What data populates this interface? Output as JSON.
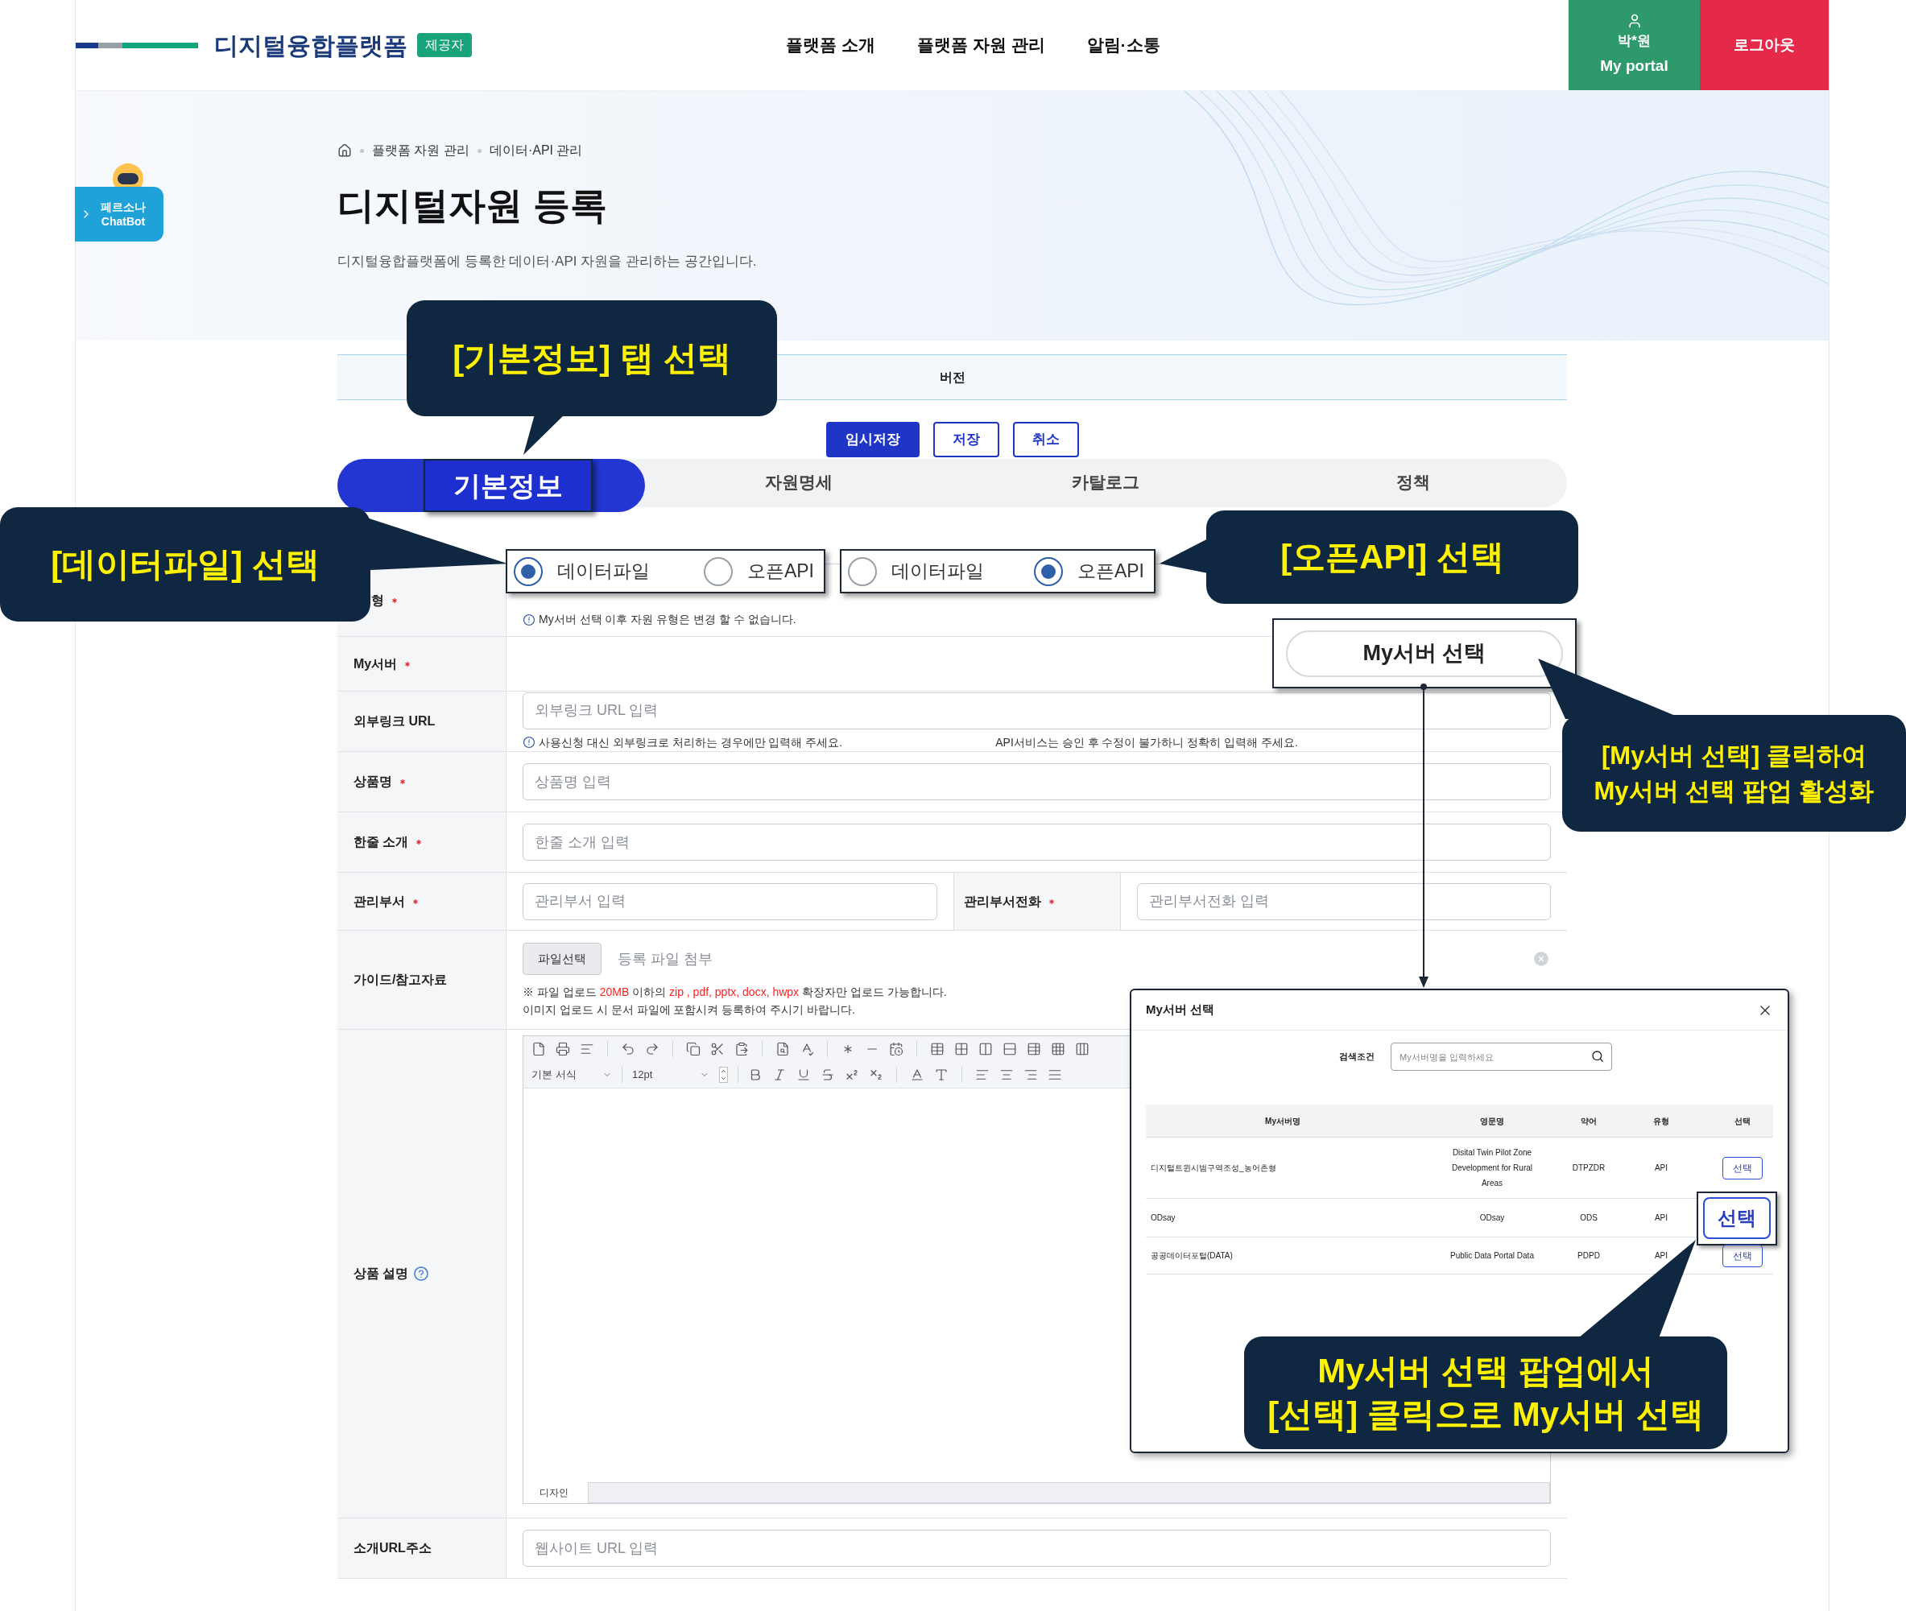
{
  "header": {
    "logo_text": "디지털융합플랫폼",
    "badge": "제공자",
    "nav": [
      "플랫폼 소개",
      "플랫폼 자원 관리",
      "알림·소통"
    ],
    "user_name": "박*원",
    "portal_label": "My portal",
    "logout_label": "로그아웃"
  },
  "chatbot": {
    "line1": "페르소나",
    "line2": "ChatBot"
  },
  "breadcrumb": [
    "플랫폼 자원 관리",
    "데이터·API 관리"
  ],
  "page_title": "디지털자원 등록",
  "page_description": "디지털융합플랫폼에 등록한 데이터·API 자원을 관리하는 공간입니다.",
  "version_label": "버전",
  "actions": [
    {
      "label": "임시저장",
      "kind": "primary"
    },
    {
      "label": "저장",
      "kind": "outline"
    },
    {
      "label": "취소",
      "kind": "outline"
    }
  ],
  "tabs": [
    {
      "label": "기본정보",
      "selected": true
    },
    {
      "label": "자원명세",
      "selected": false
    },
    {
      "label": "카탈로그",
      "selected": false
    },
    {
      "label": "정책",
      "selected": false
    }
  ],
  "form": {
    "rows": [
      {
        "kind": "radio",
        "label": "형",
        "required": true,
        "note": "My서버 선택 이후 자원 유형은 변경 할 수 없습니다."
      },
      {
        "kind": "server",
        "label": "My서버",
        "required": true
      },
      {
        "kind": "input",
        "label": "외부링크 URL",
        "required": false,
        "placeholder": "외부링크 URL 입력",
        "note": "사용신청 대신 외부링크로 처리하는 경우에만 입력해 주세요.",
        "side_note": "API서비스는 승인 후 수정이 불가하니 정확히 입력해 주세요."
      },
      {
        "kind": "input",
        "label": "상품명",
        "required": true,
        "placeholder": "상품명 입력"
      },
      {
        "kind": "input",
        "label": "한줄 소개",
        "required": true,
        "placeholder": "한줄 소개 입력"
      },
      {
        "kind": "split",
        "label": "관리부서",
        "required": true,
        "placeholder": "관리부서 입력",
        "sub_label": "관리부서전화",
        "sub_required": true,
        "sub_placeholder": "관리부서전화 입력"
      },
      {
        "kind": "file",
        "label": "가이드/참고자료",
        "required": false,
        "button": "파일선택",
        "placeholder": "등록 파일 첨부",
        "note_parts": [
          {
            "text": "※ 파일 업로드 ",
            "highlight": false
          },
          {
            "text": "20MB",
            "highlight": true
          },
          {
            "text": " 이하의 ",
            "highlight": false
          },
          {
            "text": "zip , pdf, pptx, docx, hwpx",
            "highlight": true
          },
          {
            "text": " 확장자만 업로드 가능합니다.",
            "highlight": false
          }
        ],
        "note2": "이미지 업로드 시 문서 파일에 포함시켜 등록하여 주시기 바랍니다."
      },
      {
        "kind": "editor",
        "label": "상품 설명",
        "required": false,
        "format": "기본 서식",
        "size": "12pt",
        "design_tab": "디자인"
      },
      {
        "kind": "input",
        "label": "소개URL주소",
        "required": false,
        "placeholder": "웹사이트 URL 입력"
      }
    ]
  },
  "radio_highlights": [
    {
      "options": [
        {
          "label": "데이터파일",
          "selected": true
        },
        {
          "label": "오픈API",
          "selected": false
        }
      ]
    },
    {
      "options": [
        {
          "label": "데이터파일",
          "selected": false
        },
        {
          "label": "오픈API",
          "selected": true
        }
      ]
    }
  ],
  "server_button": "My서버 선택",
  "popup": {
    "title": "My서버 선택",
    "search_label": "검색조건",
    "search_placeholder": "My서버명을 입력하세요",
    "columns": [
      "My서버명",
      "영문명",
      "약어",
      "유형",
      "선택"
    ],
    "rows": [
      {
        "name": "디지털트윈시범구역조성_농어촌형",
        "english": "Disital Twin Pilot Zone Development for Rural Areas",
        "abbr": "DTPZDR",
        "type": "API",
        "action": "선택",
        "highlighted": false
      },
      {
        "name": "ODsay",
        "english": "ODsay",
        "abbr": "ODS",
        "type": "API",
        "action": "선택",
        "highlighted": true
      },
      {
        "name": "공공데이터포털(DATA)",
        "english": "Public Data Portal Data",
        "abbr": "PDPD",
        "type": "API",
        "action": "선택",
        "highlighted": false
      }
    ]
  },
  "callouts": [
    {
      "lines": [
        "[기본정보] 탭 선택"
      ]
    },
    {
      "lines": [
        "[데이터파일] 선택"
      ]
    },
    {
      "lines": [
        "[오픈API] 선택"
      ]
    },
    {
      "lines": [
        "[My서버 선택] 클릭하여",
        "My서버 선택 팝업 활성화"
      ]
    },
    {
      "lines": [
        "My서버 선택 팝업에서",
        "[선택] 클릭으로 My서버 선택"
      ]
    }
  ]
}
